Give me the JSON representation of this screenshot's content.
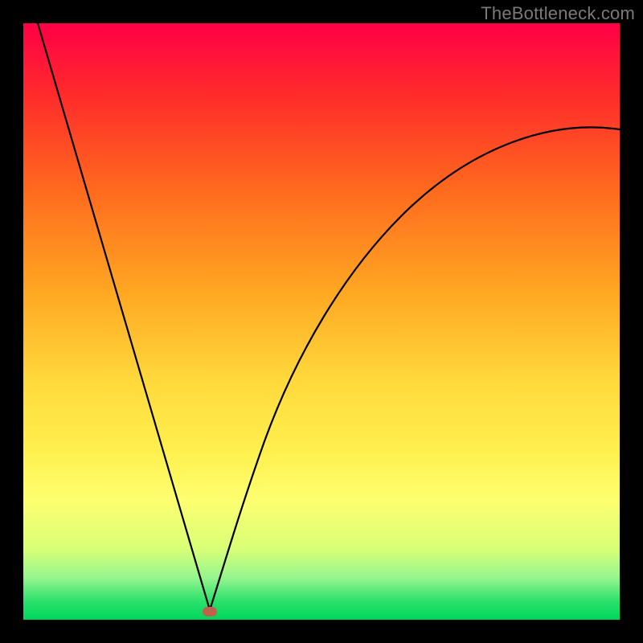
{
  "watermark": "TheBottleneck.com",
  "colors": {
    "background_black": "#000000",
    "curve_stroke": "#000000",
    "dot_fill": "#c0614e",
    "gradient_top": "#ff0046",
    "gradient_bottom": "#00d65c"
  },
  "chart_data": {
    "type": "line",
    "title": "",
    "xlabel": "",
    "ylabel": "",
    "xlim": [
      0,
      100
    ],
    "ylim": [
      0,
      100
    ],
    "grid": false,
    "series": [
      {
        "name": "left-branch",
        "x": [
          2,
          6,
          10,
          14,
          18,
          22,
          26,
          28,
          30,
          31.5
        ],
        "values": [
          100,
          87,
          74,
          60,
          46,
          33,
          19,
          12,
          5,
          1
        ]
      },
      {
        "name": "right-branch",
        "x": [
          31.5,
          33,
          36,
          40,
          45,
          50,
          56,
          63,
          72,
          82,
          92,
          100
        ],
        "values": [
          1,
          6,
          15,
          26,
          37,
          46,
          54,
          62,
          69,
          75,
          79,
          82
        ]
      }
    ],
    "annotations": [
      {
        "name": "minimum-point",
        "x": 31.5,
        "y": 1
      }
    ]
  }
}
